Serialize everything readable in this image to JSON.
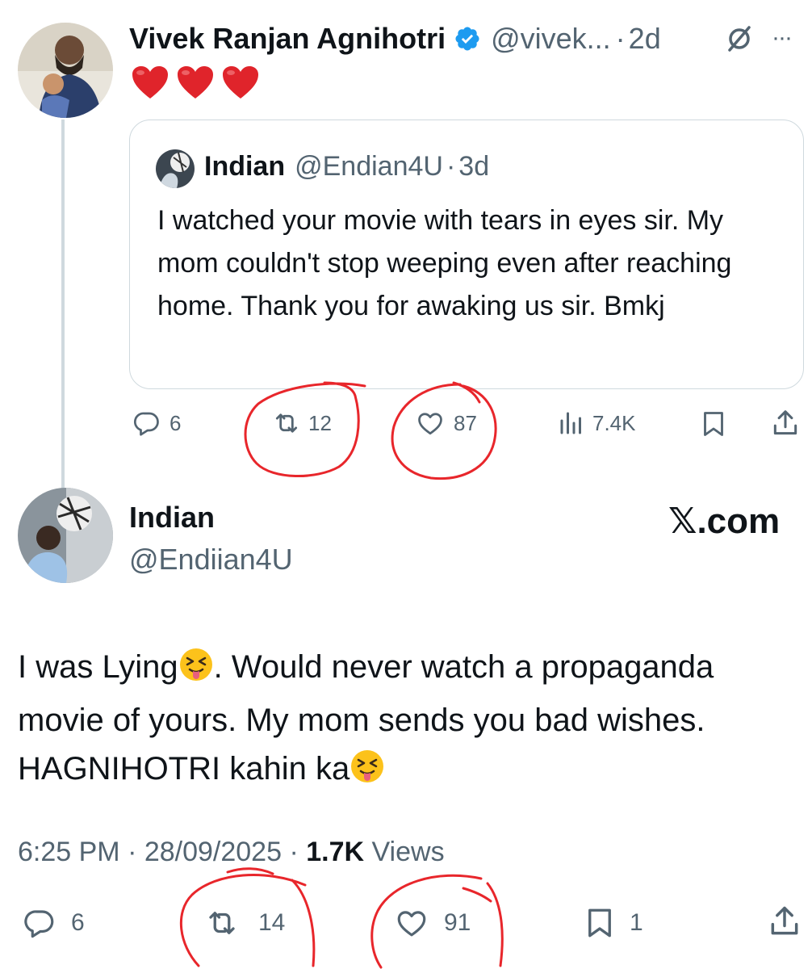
{
  "tweet1": {
    "author_name": "Vivek Ranjan Agnihotri",
    "handle": "@vivek...",
    "separator": "·",
    "time": "2d",
    "more": "···",
    "body_emojis": [
      "red-heart",
      "red-heart",
      "red-heart"
    ],
    "quote": {
      "author_name": "Indian",
      "handle": "@Endian4U",
      "separator": "·",
      "time": "3d",
      "text": "I watched your movie with tears in eyes sir. My mom couldn't stop weeping even after reaching home. Thank you for awaking us sir. Bmkj"
    },
    "actions": {
      "replies": "6",
      "reposts": "12",
      "likes": "87",
      "views": "7.4K"
    }
  },
  "tweet2": {
    "author_name": "Indian",
    "handle": "@Endiian4U",
    "brand": "𝕏.com",
    "text_line1_a": "I was Lying",
    "text_line1_b": ". Would never watch a propaganda",
    "text_line2": "movie of yours. My mom sends you bad wishes.",
    "text_line3": "HAGNIHOTRI kahin ka",
    "timestamp": "6:25 PM · 28/09/2025 · ",
    "views_count": "1.7K",
    "views_label": " Views",
    "actions": {
      "replies": "6",
      "reposts": "14",
      "likes": "91",
      "bookmarks": "1"
    }
  },
  "colors": {
    "verified_blue": "#1d9bf0",
    "secondary_text": "#536471",
    "annotation_red": "#e8262b",
    "heart_red": "#e0242b"
  },
  "icons": [
    "verified-badge-icon",
    "grok-icon",
    "more-icon",
    "reply-icon",
    "repost-icon",
    "like-icon",
    "views-icon",
    "bookmark-icon",
    "share-icon",
    "tongue-emoji-icon"
  ]
}
